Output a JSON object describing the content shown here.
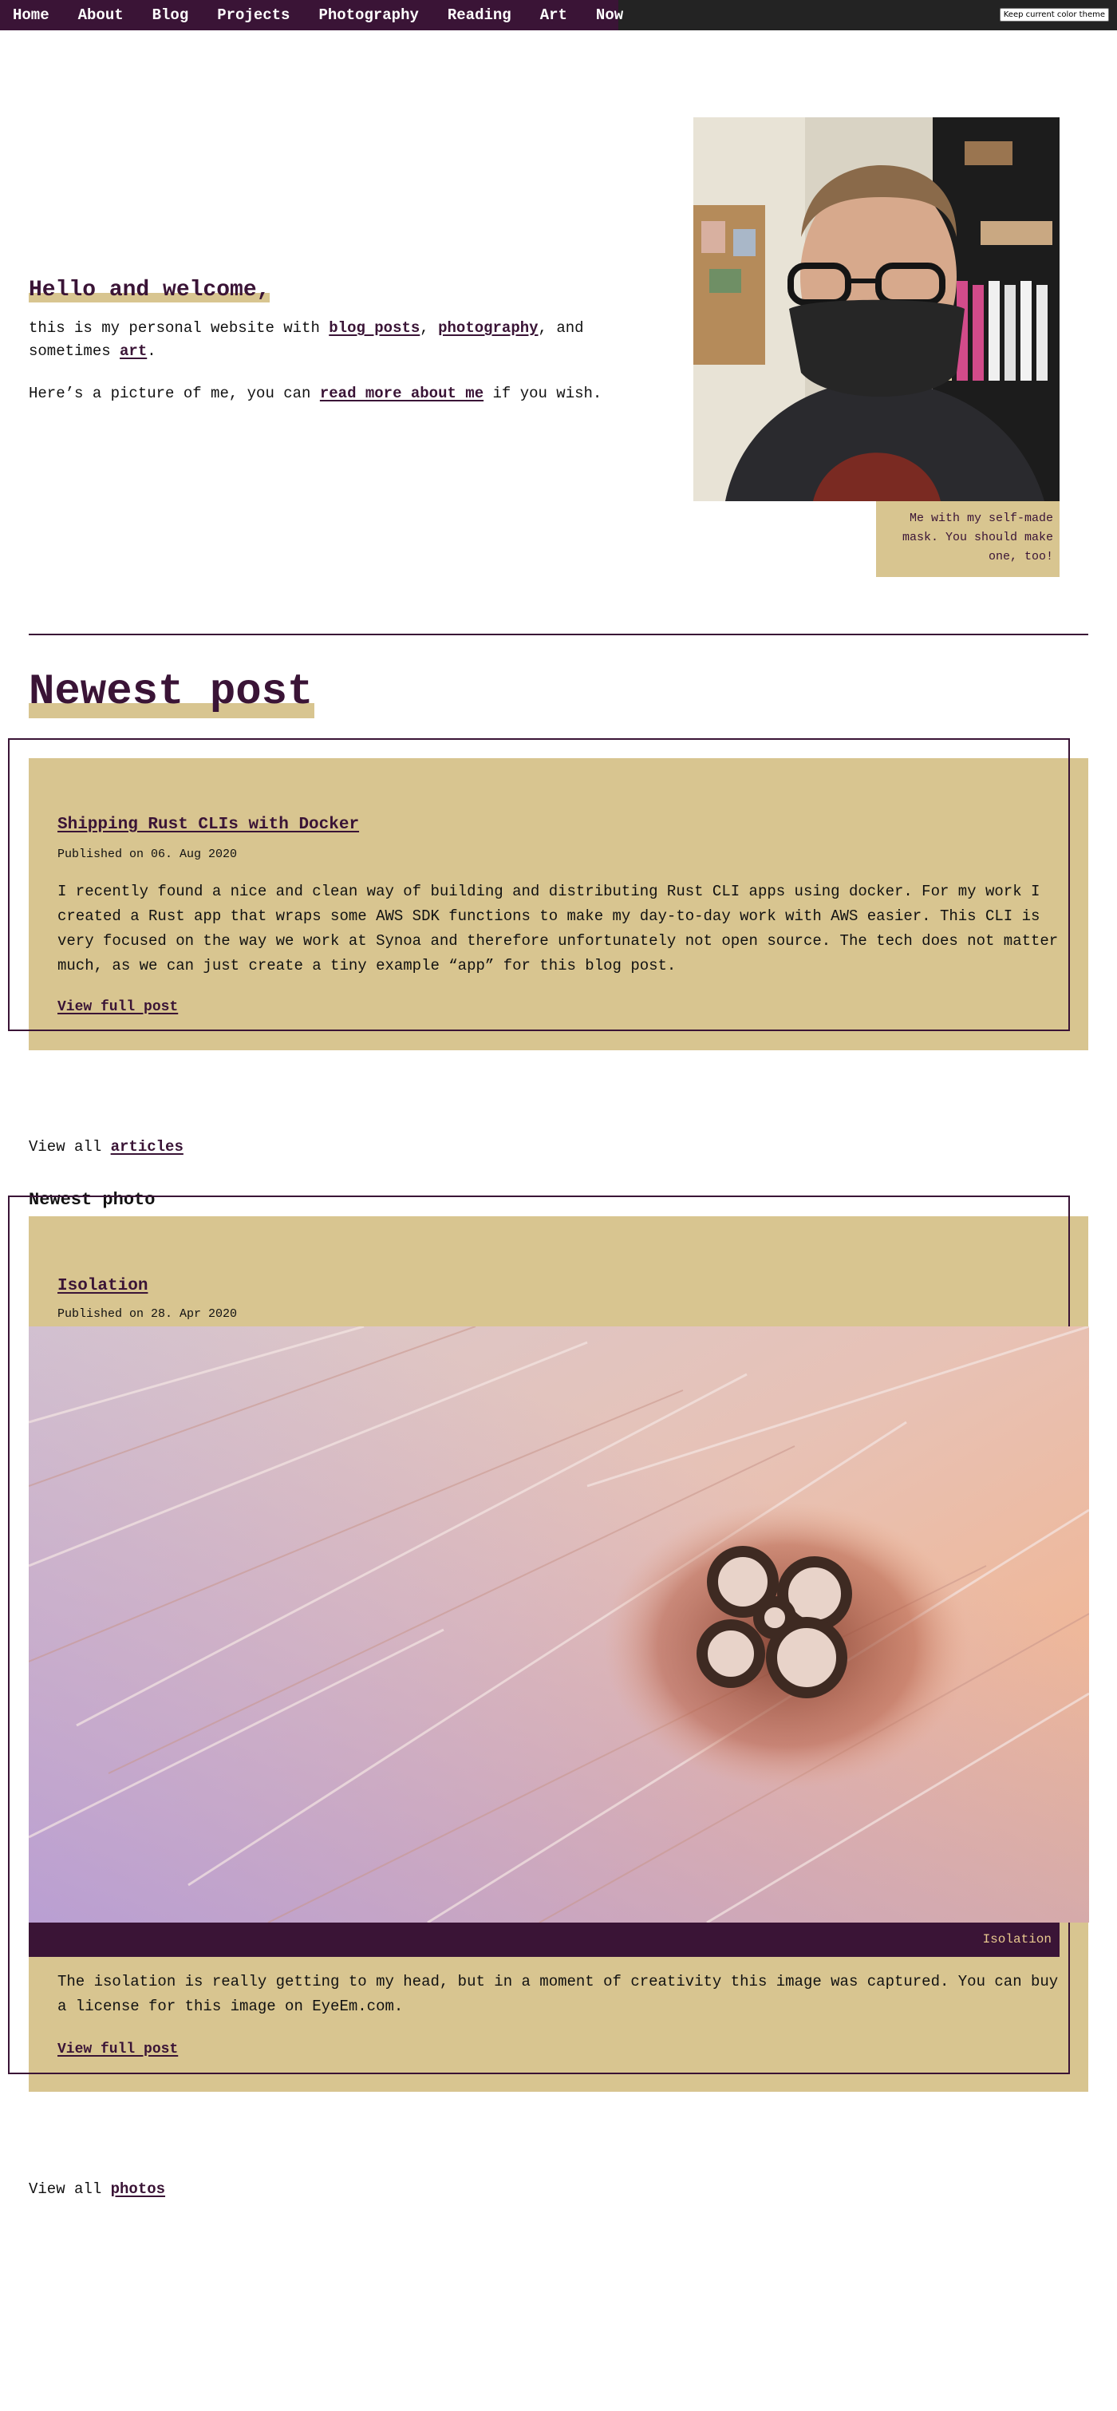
{
  "nav": {
    "items": [
      "Home",
      "About",
      "Blog",
      "Projects",
      "Photography",
      "Reading",
      "Art",
      "Now"
    ],
    "theme_button": "Keep current color theme"
  },
  "hero": {
    "title": "Hello and welcome,",
    "intro_prefix": "this is my personal website with ",
    "link_blog": "blog posts",
    "sep1": ", ",
    "link_photography": "photography",
    "sep2": ", and sometimes ",
    "link_art": "art",
    "end1": ".",
    "picture_prefix": "Here’s a picture of me, you can ",
    "link_about": "read more about me",
    "picture_suffix": " if you wish.",
    "portrait_caption": "Me with my self-made mask. You should make one, too!"
  },
  "newest_post": {
    "heading": "Newest post",
    "title": "Shipping Rust CLIs with Docker",
    "date": "Published on 06. Aug 2020",
    "text": "I recently found a nice and clean way of building and distributing Rust CLI apps using docker. For my work I created a Rust app that wraps some AWS SDK functions to make my day-to-day work with AWS easier. This CLI is very focused on the way we work at Synoa and therefore unfortunately not open source. The tech does not matter much, as we can just create a tiny example “app” for this blog post.",
    "link": "View full post",
    "view_all_prefix": "View all ",
    "view_all_link": "articles"
  },
  "newest_photo": {
    "heading": "Newest photo",
    "title": "Isolation",
    "date": "Published on 28. Apr 2020",
    "image_caption": "Isolation",
    "text": "The isolation is really getting to my head, but in a moment of creativity this image was captured. You can buy a license for this image on EyeEm.com.",
    "link": "View full post",
    "view_all_prefix": "View all ",
    "view_all_link": "photos"
  },
  "colors": {
    "brand": "#3a1436",
    "accent": "#d8c590",
    "topbar": "#232323"
  }
}
